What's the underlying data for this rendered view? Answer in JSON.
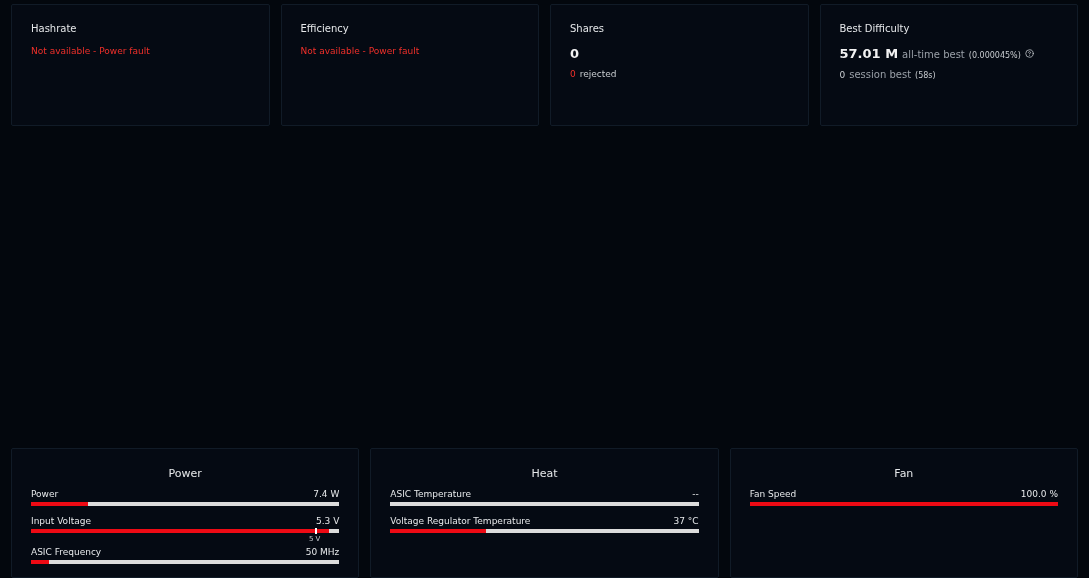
{
  "stat_cards": [
    {
      "title": "Hashrate",
      "kind": "error",
      "message": "Not available - Power fault"
    },
    {
      "title": "Efficiency",
      "kind": "error",
      "message": "Not available - Power fault"
    },
    {
      "title": "Shares",
      "kind": "shares",
      "value": "0",
      "rejected_count": "0",
      "rejected_label": "rejected"
    },
    {
      "title": "Best Difficulty",
      "kind": "difficulty",
      "value": "57.01 M",
      "value_label": "all-time best",
      "percent": "(0.000045%)",
      "session_value": "0",
      "session_label": "session best",
      "session_time": "(58s)"
    }
  ],
  "panels": [
    {
      "title": "Power",
      "meters": [
        {
          "label": "Power",
          "reading": "7.4 W",
          "level": 0.185
        },
        {
          "label": "Input Voltage",
          "reading": "5.3 V",
          "level": 0.965,
          "marker": {
            "label": "5 V",
            "level": 0.92
          }
        },
        {
          "label": "ASIC Frequency",
          "reading": "50 MHz",
          "level": 0.06
        }
      ]
    },
    {
      "title": "Heat",
      "meters": [
        {
          "label": "ASIC Temperature",
          "reading": "--"
        },
        {
          "label": "Voltage Regulator Temperature",
          "reading": "37 °C",
          "level": 0.31
        }
      ]
    },
    {
      "title": "Fan",
      "meters": [
        {
          "label": "Fan Speed",
          "reading": "100.0 %",
          "level": 1
        }
      ]
    }
  ]
}
